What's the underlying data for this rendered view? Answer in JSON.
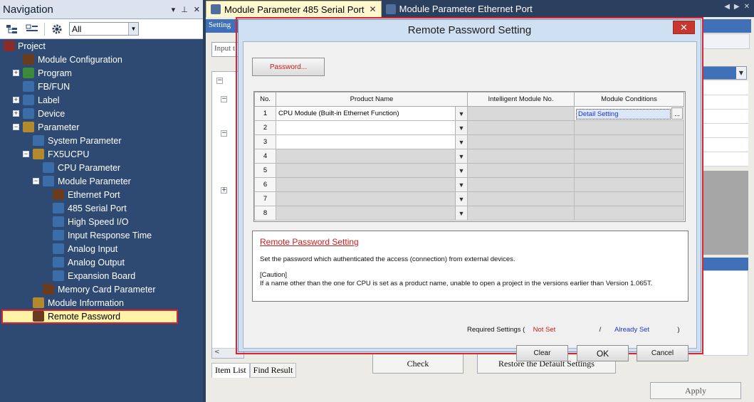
{
  "navigation": {
    "title": "Navigation",
    "pin_icons": [
      "▾",
      "⊥",
      "✕"
    ],
    "filter_value": "All",
    "tree": [
      {
        "label": "Project",
        "icon": "project-icon",
        "depth": 0,
        "expander": "",
        "color": "#8a2b2b"
      },
      {
        "label": "Module Configuration",
        "icon": "module-config-icon",
        "depth": 1,
        "expander": "",
        "color": "#6a3b1d"
      },
      {
        "label": "Program",
        "icon": "program-icon",
        "depth": 1,
        "expander": "+",
        "color": "#3b8a3b"
      },
      {
        "label": "FB/FUN",
        "icon": "fbfun-icon",
        "depth": 1,
        "expander": "",
        "color": "#3b6da8"
      },
      {
        "label": "Label",
        "icon": "label-icon",
        "depth": 1,
        "expander": "+",
        "color": "#3b6da8"
      },
      {
        "label": "Device",
        "icon": "device-icon",
        "depth": 1,
        "expander": "+",
        "color": "#3b6da8"
      },
      {
        "label": "Parameter",
        "icon": "parameter-icon",
        "depth": 1,
        "expander": "−",
        "color": "#b38a2b"
      },
      {
        "label": "System Parameter",
        "icon": "system-parameter-icon",
        "depth": 2,
        "expander": "",
        "color": "#3b6da8"
      },
      {
        "label": "FX5UCPU",
        "icon": "cpu-icon",
        "depth": 2,
        "expander": "−",
        "color": "#b38a2b"
      },
      {
        "label": "CPU Parameter",
        "icon": "cpu-parameter-icon",
        "depth": 3,
        "expander": "",
        "color": "#3b6da8"
      },
      {
        "label": "Module Parameter",
        "icon": "module-parameter-icon",
        "depth": 3,
        "expander": "−",
        "color": "#3b6da8"
      },
      {
        "label": "Ethernet Port",
        "icon": "ethernet-port-icon",
        "depth": 4,
        "expander": "",
        "color": "#6a3b1d"
      },
      {
        "label": "485 Serial Port",
        "icon": "serial-port-icon",
        "depth": 4,
        "expander": "",
        "color": "#3b6da8"
      },
      {
        "label": "High Speed I/O",
        "icon": "high-speed-io-icon",
        "depth": 4,
        "expander": "",
        "color": "#3b6da8"
      },
      {
        "label": "Input Response Time",
        "icon": "input-response-icon",
        "depth": 4,
        "expander": "",
        "color": "#3b6da8"
      },
      {
        "label": "Analog Input",
        "icon": "analog-input-icon",
        "depth": 4,
        "expander": "",
        "color": "#3b6da8"
      },
      {
        "label": "Analog Output",
        "icon": "analog-output-icon",
        "depth": 4,
        "expander": "",
        "color": "#3b6da8"
      },
      {
        "label": "Expansion Board",
        "icon": "expansion-board-icon",
        "depth": 4,
        "expander": "",
        "color": "#3b6da8"
      },
      {
        "label": "Memory Card Parameter",
        "icon": "memory-card-icon",
        "depth": 3,
        "expander": "",
        "color": "#6a3b1d"
      },
      {
        "label": "Module Information",
        "icon": "module-info-icon",
        "depth": 2,
        "expander": "",
        "color": "#b38a2b"
      },
      {
        "label": "Remote Password",
        "icon": "remote-password-icon",
        "depth": 2,
        "expander": "",
        "color": "#6a3b1d",
        "selected": true
      }
    ]
  },
  "tabs": [
    {
      "label": "Module Parameter 485 Serial Port",
      "active": true,
      "close": "✕"
    },
    {
      "label": "Module Parameter Ethernet Port",
      "active": false
    }
  ],
  "background": {
    "setting_label": "Setting",
    "input_placeholder": "Input t",
    "h_scroll_arrow": "<",
    "bottom_tabs": [
      "Item List",
      "Find Result"
    ],
    "check_label": "Check",
    "restore_label": "Restore the Default Settings",
    "apply_label": "Apply"
  },
  "dialog": {
    "title": "Remote Password Setting",
    "close_glyph": "✕",
    "password_button": "Password...",
    "columns": [
      "No.",
      "Product Name",
      "Intelligent Module No.",
      "Module Conditions"
    ],
    "rows": [
      {
        "no": "1",
        "product": "CPU Module (Built-in Ethernet Function)",
        "condition": "Detail Setting",
        "editable": true
      },
      {
        "no": "2",
        "product": "",
        "condition": "",
        "editable": true
      },
      {
        "no": "3",
        "product": "",
        "condition": "",
        "editable": true
      },
      {
        "no": "4",
        "product": "",
        "condition": "",
        "editable": false
      },
      {
        "no": "5",
        "product": "",
        "condition": "",
        "editable": false
      },
      {
        "no": "6",
        "product": "",
        "condition": "",
        "editable": false
      },
      {
        "no": "7",
        "product": "",
        "condition": "",
        "editable": false
      },
      {
        "no": "8",
        "product": "",
        "condition": "",
        "editable": false
      }
    ],
    "more_glyph": "...",
    "description": {
      "title": "Remote Password Setting",
      "text": "Set the password which authenticated the access (connection) from external devices.",
      "caution_label": "[Caution]",
      "caution_text": "If a name other than the one for CPU is set as a product name, unable to open a project in the versions earlier than Version 1.065T."
    },
    "required": {
      "prefix": "Required Settings (",
      "not_set": "Not Set",
      "separator": "/",
      "already_set": "Already Set",
      "suffix": ")"
    },
    "buttons": {
      "clear": "Clear",
      "ok": "OK",
      "cancel": "Cancel"
    }
  },
  "colors": {
    "accent": "#3f70b8",
    "highlight_red": "#e0222f",
    "selected_bg": "#fff3a8",
    "link_blue": "#1c36c8"
  }
}
